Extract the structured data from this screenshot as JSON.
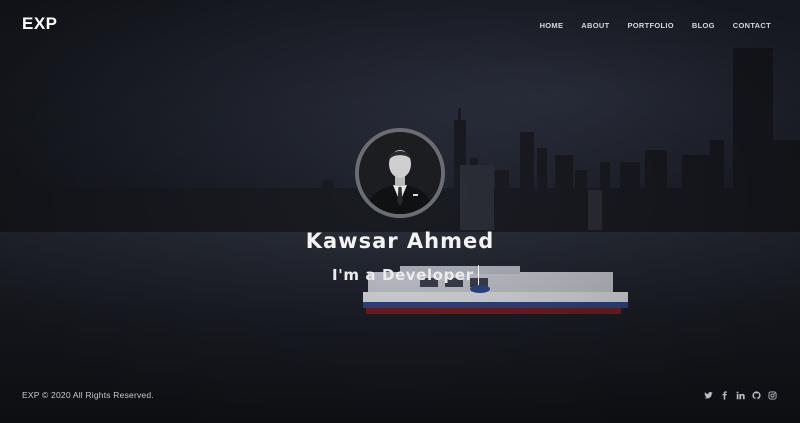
{
  "header": {
    "logo_text": "EXP",
    "nav": [
      "HOME",
      "ABOUT",
      "PORTFOLIO",
      "BLOG",
      "CONTACT"
    ]
  },
  "hero": {
    "name": "Kawsar Ahmed",
    "tagline": "I'm a Developer"
  },
  "footer": {
    "copyright": "EXP © 2020 All Rights Reserved.",
    "social_icons": [
      "twitter-icon",
      "facebook-icon",
      "linkedin-icon",
      "github-icon",
      "instagram-icon"
    ]
  },
  "colors": {
    "background": "#14161d",
    "text": "#ffffff",
    "nav_text": "#d4d6dc",
    "avatar_ring": "#6b6d73"
  }
}
